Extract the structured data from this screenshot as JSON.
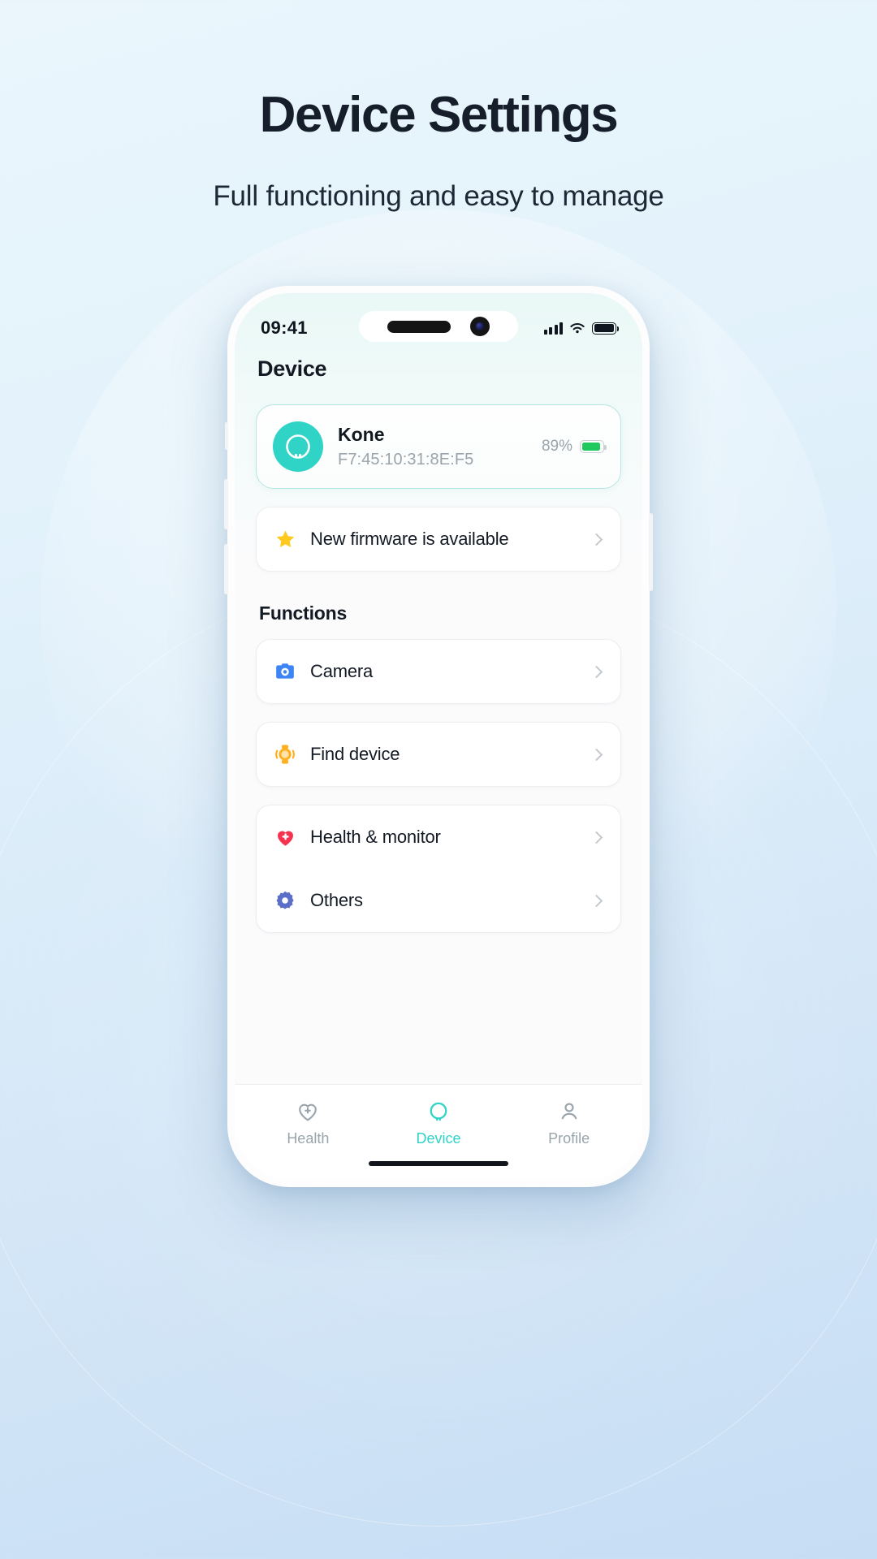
{
  "hero": {
    "title": "Device Settings",
    "subtitle": "Full functioning and easy to manage"
  },
  "phone": {
    "status_bar": {
      "time": "09:41",
      "signal_icon": "cellular-signal-icon",
      "wifi_icon": "wifi-icon",
      "battery_icon": "battery-icon"
    },
    "screen_title": "Device",
    "device_card": {
      "avatar_icon": "device-ring-icon",
      "name": "Kone",
      "mac_address": "F7:45:10:31:8E:F5",
      "battery_percent": "89%",
      "battery_icon": "battery-full-icon",
      "battery_color": "#20c95e",
      "accent_color": "#2fd4c6"
    },
    "firmware_row": {
      "icon": "star-icon",
      "icon_color": "#ffc91d",
      "label": "New firmware is available",
      "chevron": "chevron-right-icon"
    },
    "functions_label": "Functions",
    "function_groups": [
      {
        "rows": [
          {
            "icon": "camera-icon",
            "icon_color": "#3d85f7",
            "label": "Camera",
            "chevron": "chevron-right-icon"
          }
        ]
      },
      {
        "rows": [
          {
            "icon": "watch-find-icon",
            "icon_color": "#ffb020",
            "label": "Find device",
            "chevron": "chevron-right-icon"
          }
        ]
      },
      {
        "rows": [
          {
            "icon": "heart-plus-icon",
            "icon_color": "#f5334f",
            "label": "Health & monitor",
            "chevron": "chevron-right-icon"
          },
          {
            "icon": "gear-icon",
            "icon_color": "#5b6fc9",
            "label": "Others",
            "chevron": "chevron-right-icon"
          }
        ]
      }
    ],
    "tabs": [
      {
        "icon": "heart-pulse-icon",
        "label": "Health",
        "active": false
      },
      {
        "icon": "device-ring-icon",
        "label": "Device",
        "active": true
      },
      {
        "icon": "person-icon",
        "label": "Profile",
        "active": false
      }
    ],
    "active_tab_color": "#2fd4c6",
    "inactive_tab_color": "#9aa4ab"
  }
}
